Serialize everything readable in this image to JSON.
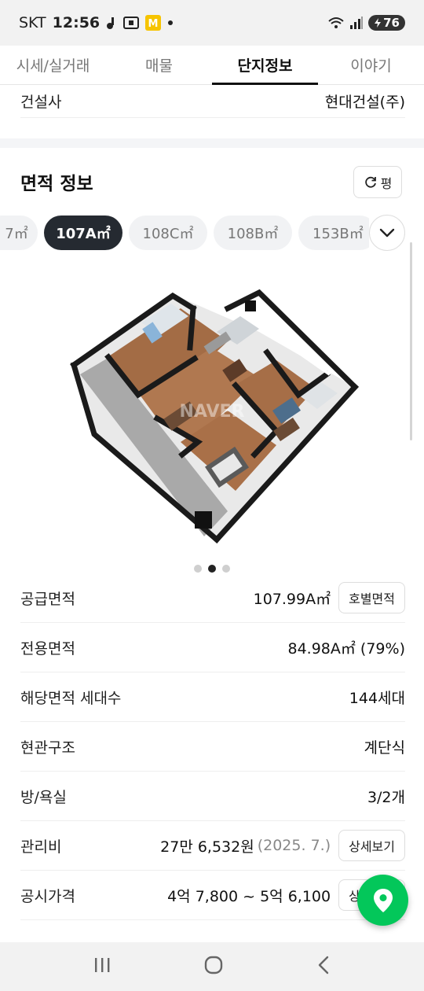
{
  "status_bar": {
    "carrier": "SKT",
    "time": "12:56",
    "notif_badge": "M",
    "battery": "76"
  },
  "tabs": [
    {
      "label": "시세/실거래",
      "active": false
    },
    {
      "label": "매물",
      "active": false
    },
    {
      "label": "단지정보",
      "active": true
    },
    {
      "label": "이야기",
      "active": false
    }
  ],
  "builder": {
    "label": "건설사",
    "value": "현대건설(주)"
  },
  "area_section": {
    "title": "면적 정보",
    "unit_toggle": "평",
    "chips": [
      {
        "label": "7㎡",
        "active": false
      },
      {
        "label": "107A㎡",
        "active": true
      },
      {
        "label": "108C㎡",
        "active": false
      },
      {
        "label": "108B㎡",
        "active": false
      },
      {
        "label": "153B㎡",
        "active": false
      }
    ],
    "watermark": "NAVER",
    "carousel": {
      "current": 2,
      "total": 3
    }
  },
  "info_rows": [
    {
      "label": "공급면적",
      "value": "107.99A㎡",
      "sub": "",
      "button": "호별면적"
    },
    {
      "label": "전용면적",
      "value": "84.98A㎡ (79%)",
      "sub": "",
      "button": ""
    },
    {
      "label": "해당면적 세대수",
      "value": "144세대",
      "sub": "",
      "button": ""
    },
    {
      "label": "현관구조",
      "value": "계단식",
      "sub": "",
      "button": ""
    },
    {
      "label": "방/욕실",
      "value": "3/2개",
      "sub": "",
      "button": ""
    },
    {
      "label": "관리비",
      "value": "27만 6,532원",
      "sub": "(2025. 7.)",
      "button": "상세보기"
    },
    {
      "label": "공시가격",
      "value": "4억 7,800 ~ 5억 6,100",
      "sub": "",
      "button": "상세보기"
    }
  ],
  "colors": {
    "accent": "#03c75a",
    "chip_active": "#252a31"
  }
}
